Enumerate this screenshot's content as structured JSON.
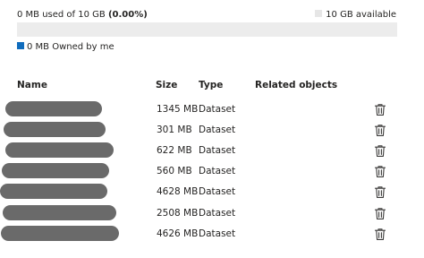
{
  "storage": {
    "used_text": "0 MB used of 10 GB ",
    "used_percent_text": "(0.00%)",
    "available_text": "10 GB available",
    "used_fraction": 0.0,
    "owned_text": "0 MB Owned by me"
  },
  "colors": {
    "owned": "#0f6cbd",
    "available": "#e6e6e6"
  },
  "table": {
    "headers": {
      "name": "Name",
      "size": "Size",
      "type": "Type",
      "related": "Related objects"
    },
    "rows": [
      {
        "size": "1345 MB",
        "type": "Dataset",
        "icon": "trash-icon"
      },
      {
        "size": "301 MB",
        "type": "Dataset",
        "icon": "trash-icon"
      },
      {
        "size": "622 MB",
        "type": "Dataset",
        "icon": "trash-icon"
      },
      {
        "size": "560 MB",
        "type": "Dataset",
        "icon": "trash-icon"
      },
      {
        "size": "4628 MB",
        "type": "Dataset",
        "icon": "trash-icon"
      },
      {
        "size": "2508 MB",
        "type": "Dataset",
        "icon": "trash-icon"
      },
      {
        "size": "4626 MB",
        "type": "Dataset",
        "icon": "trash-icon"
      }
    ]
  }
}
